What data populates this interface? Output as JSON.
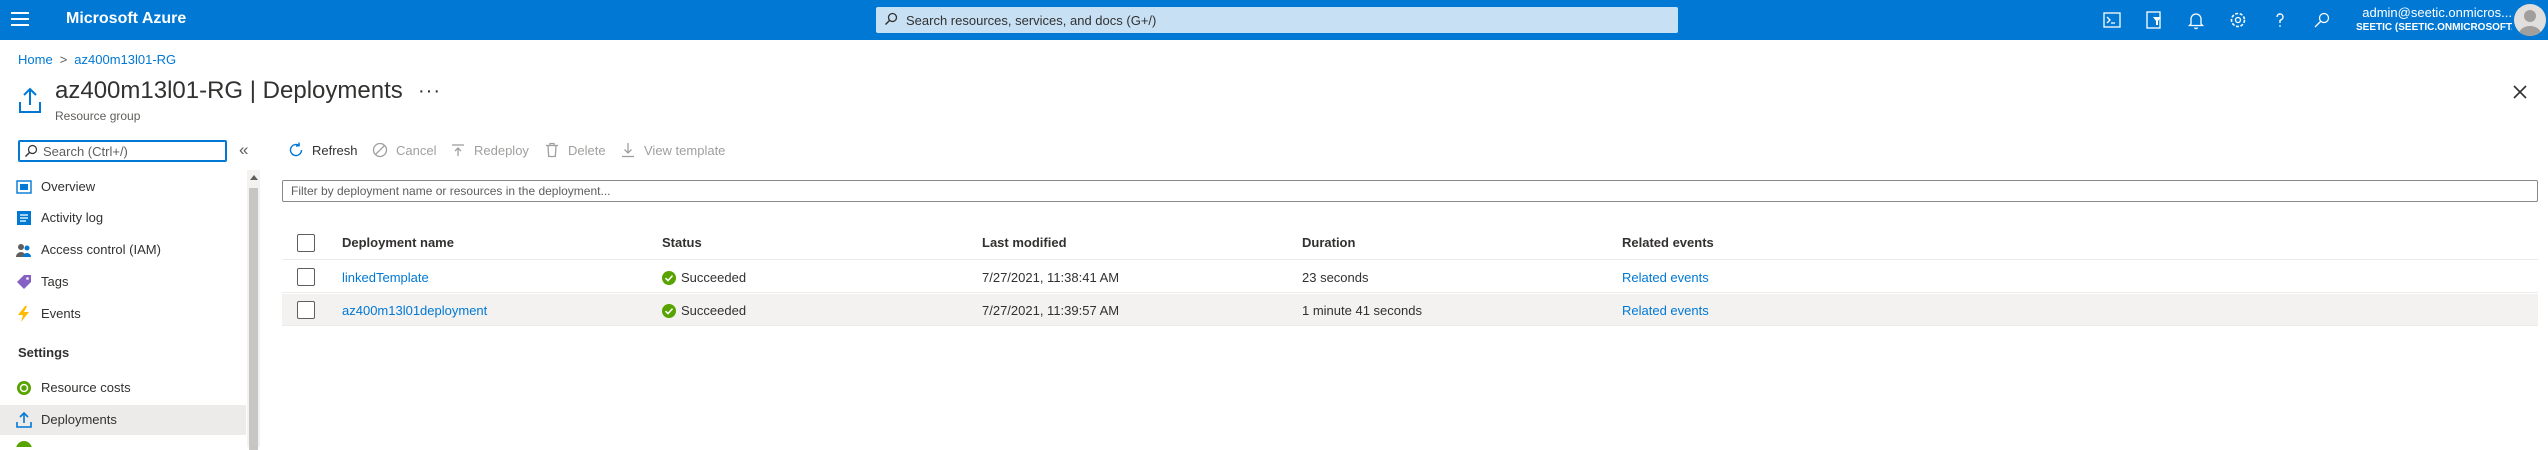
{
  "topbar": {
    "brand": "Microsoft Azure",
    "search_placeholder": "Search resources, services, and docs (G+/)",
    "account_name": "admin@seetic.onmicros...",
    "account_directory": "SEETIC (SEETIC.ONMICROSOFT.C...",
    "icons": [
      "cloud-shell-icon",
      "directory-filter-icon",
      "notifications-icon",
      "settings-icon",
      "help-icon",
      "feedback-icon"
    ]
  },
  "breadcrumb": {
    "home": "Home",
    "separator": ">",
    "resource_group": "az400m13l01-RG"
  },
  "page": {
    "title": "az400m13l01-RG | Deployments",
    "subtitle": "Resource group",
    "more": "···"
  },
  "sidebar": {
    "search_placeholder": "Search (Ctrl+/)",
    "collapse": "«",
    "items": [
      {
        "label": "Overview",
        "icon": "overview-icon"
      },
      {
        "label": "Activity log",
        "icon": "activity-log-icon"
      },
      {
        "label": "Access control (IAM)",
        "icon": "iam-icon"
      },
      {
        "label": "Tags",
        "icon": "tag-icon"
      },
      {
        "label": "Events",
        "icon": "events-icon"
      }
    ],
    "section_settings": "Settings",
    "settings_items": [
      {
        "label": "Resource costs",
        "icon": "resource-costs-icon"
      },
      {
        "label": "Deployments",
        "icon": "deployments-icon",
        "active": true
      }
    ]
  },
  "toolbar": {
    "refresh": "Refresh",
    "cancel": "Cancel",
    "redeploy": "Redeploy",
    "delete": "Delete",
    "view_template": "View template"
  },
  "filter": {
    "placeholder": "Filter by deployment name or resources in the deployment..."
  },
  "table": {
    "columns": [
      "Deployment name",
      "Status",
      "Last modified",
      "Duration",
      "Related events"
    ],
    "rows": [
      {
        "name": "linkedTemplate",
        "status": "Succeeded",
        "last_modified": "7/27/2021, 11:38:41 AM",
        "duration": "23 seconds",
        "related": "Related events"
      },
      {
        "name": "az400m13l01deployment",
        "status": "Succeeded",
        "last_modified": "7/27/2021, 11:39:57 AM",
        "duration": "1 minute 41 seconds",
        "related": "Related events"
      }
    ]
  },
  "colors": {
    "accent": "#0078d4",
    "success": "#57a300"
  }
}
